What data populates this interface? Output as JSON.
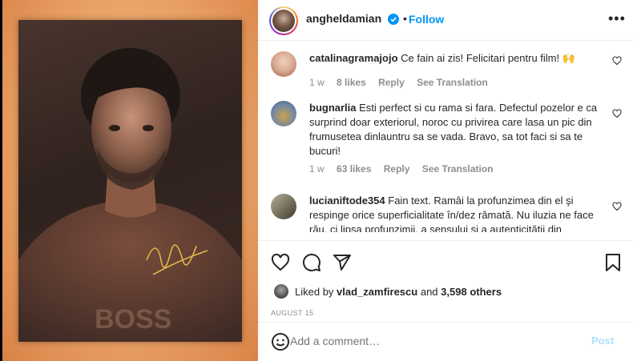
{
  "post": {
    "author": "angheldamian",
    "follow_label": "Follow",
    "dot": "•",
    "more": "•••",
    "photo_signature": "Signed portrait photo"
  },
  "comments": [
    {
      "user": "catalinagramajojo",
      "text": "Ce fain ai zis! Felicitari pentru film! 🙌",
      "time": "1 w",
      "likes": "8 likes",
      "reply": "Reply",
      "see_translation": "See Translation",
      "avatar_color": "#d9a891"
    },
    {
      "user": "bugnarlia",
      "text": "Esti perfect si cu rama si fara. Defectul pozelor e ca surprind doar exteriorul, noroc cu privirea care lasa un pic din frumusetea dinlauntru sa se vada. Bravo, sa tot faci si sa te bucuri!",
      "time": "1 w",
      "likes": "63 likes",
      "reply": "Reply",
      "see_translation": "See Translation",
      "avatar_color": "#6f86a8"
    },
    {
      "user": "lucianiftode354",
      "text": "Fain text. Ramâi la profunzimea din el şi respinge orice superficialitate în/dez râmată. Nu iluzia ne face rău, ci lipsa profunzimii, a sensului şi a autenticităţii din",
      "time": "",
      "likes": "",
      "reply": "",
      "see_translation": "",
      "avatar_color": "#7a7560"
    }
  ],
  "likes": {
    "prefix": "Liked by",
    "user": "vlad_zamfirescu",
    "and": "and",
    "others": "3,598 others"
  },
  "date": "AUGUST 15",
  "add_comment": {
    "placeholder": "Add a comment…",
    "post_label": "Post"
  },
  "icons": {
    "verified": "verified-badge-icon",
    "heart": "heart-icon",
    "comment": "comment-icon",
    "share": "share-icon",
    "save": "bookmark-icon",
    "emoji": "emoji-icon"
  },
  "colors": {
    "link": "#0095f6",
    "muted": "#8e8e8e",
    "post_disabled": "#b2dffc",
    "frame": "#eba467"
  }
}
